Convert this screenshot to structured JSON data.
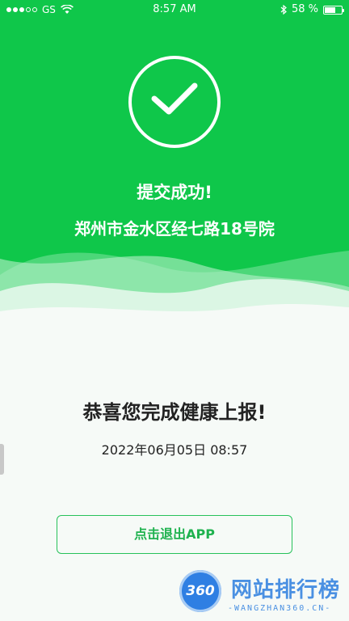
{
  "status_bar": {
    "carrier": "GS",
    "time": "8:57 AM",
    "battery": "58 %",
    "battery_level": 0.58,
    "signal_bars_filled": 3,
    "signal_bars_total": 5
  },
  "result": {
    "title": "提交成功!",
    "address": "郑州市金水区经七路18号院",
    "congrats": "恭喜您完成健康上报!",
    "datetime": "2022年06月05日  08:57"
  },
  "actions": {
    "exit_label": "点击退出APP"
  },
  "watermark": {
    "logo": "360",
    "name": "网站排行榜",
    "domain": "-WANGZHAN360.CN-"
  },
  "colors": {
    "header_green": "#0fc74a",
    "button_green": "#1fb24f",
    "watermark_blue": "#4a90e2"
  },
  "icons": {
    "success": "check-circle-icon",
    "wifi": "wifi-icon",
    "bluetooth": "bluetooth-icon",
    "battery": "battery-icon"
  }
}
